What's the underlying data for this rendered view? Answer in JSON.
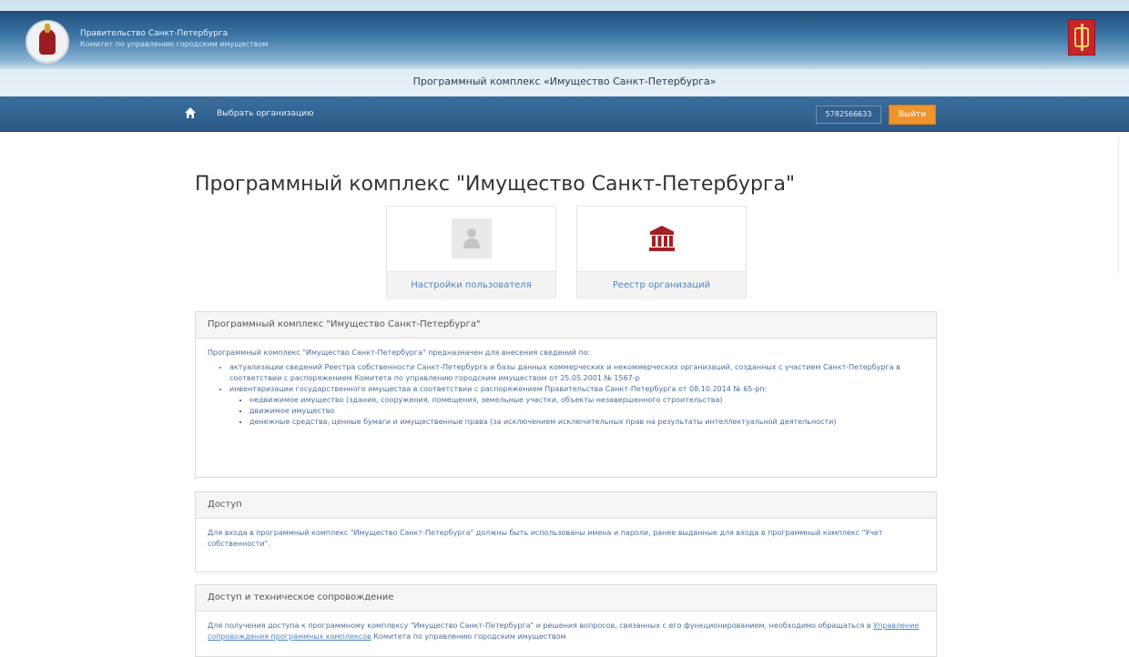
{
  "banner": {
    "gov_name": "Правительство Санкт-Петербурга",
    "committee": "Комитет по управлению городским имуществом",
    "app_title": "Программный комплекс «Имущество Санкт-Петербурга»",
    "emblem_icon": "spb-emblem-icon",
    "flag_icon": "spb-flag-icon"
  },
  "nav": {
    "home_icon": "home-icon",
    "select_org": "Выбрать организацию",
    "user_id": "5782566633",
    "logout": "Выйти"
  },
  "colors": {
    "nav_bar": "#2c5a87",
    "logout_button": "#f0932b",
    "link": "#4a86c3",
    "registry_icon": "#a31f24"
  },
  "main": {
    "title": "Программный комплекс \"Имущество Санкт-Петербурга\"",
    "tiles": [
      {
        "label": "Настройки пользователя",
        "icon": "user-icon"
      },
      {
        "label": "Реестр организаций",
        "icon": "institution-icon"
      }
    ]
  },
  "panels": {
    "about": {
      "heading": "Программный комплекс \"Имущество Санкт-Петербурга\"",
      "intro": "Программный комплекс \"Имущество Санкт-Петербурга\" предназначен для внесения сведений по:",
      "items": [
        "актуализации сведений Реестра собственности Санкт-Петербурга и базы данных коммерческих и некоммерческих организаций, созданных с участием Санкт-Петербурга в соответствии с распоряжением Комитета по управлению городским имуществом от 25.05.2001 № 1567-р",
        "инвентаризации государственного имущества в соответствии с распоряжением Правительства Санкт-Петербурга от 08.10.2014 № 65-рп:"
      ],
      "subitems": [
        "недвижимое имущество (здания, сооружения, помещения, земельные участки, объекты незавершенного строительства)",
        "движимое имущество",
        "денежные средства, ценные бумаги и имущественные права (за исключением исключительных прав на результаты интеллектуальной деятельности)"
      ]
    },
    "access": {
      "heading": "Доступ",
      "text": "Для входа в программный комплекс \"Имущество Санкт-Петербурга\" должны быть использованы имена и пароли, ранее выданные для входа в программный комплекс \"Учет собственности\"."
    },
    "support": {
      "heading": "Доступ и техническое сопровождение",
      "text_before": "Для получения доступа к программному комплексу \"Имущество Санкт-Петербурга\" и решения вопросов, связанных с его функционированием, необходимо обращаться в",
      "link": "Управление сопровождения программных комплексов",
      "text_after": "Комитета по управлению городским имуществом"
    }
  }
}
